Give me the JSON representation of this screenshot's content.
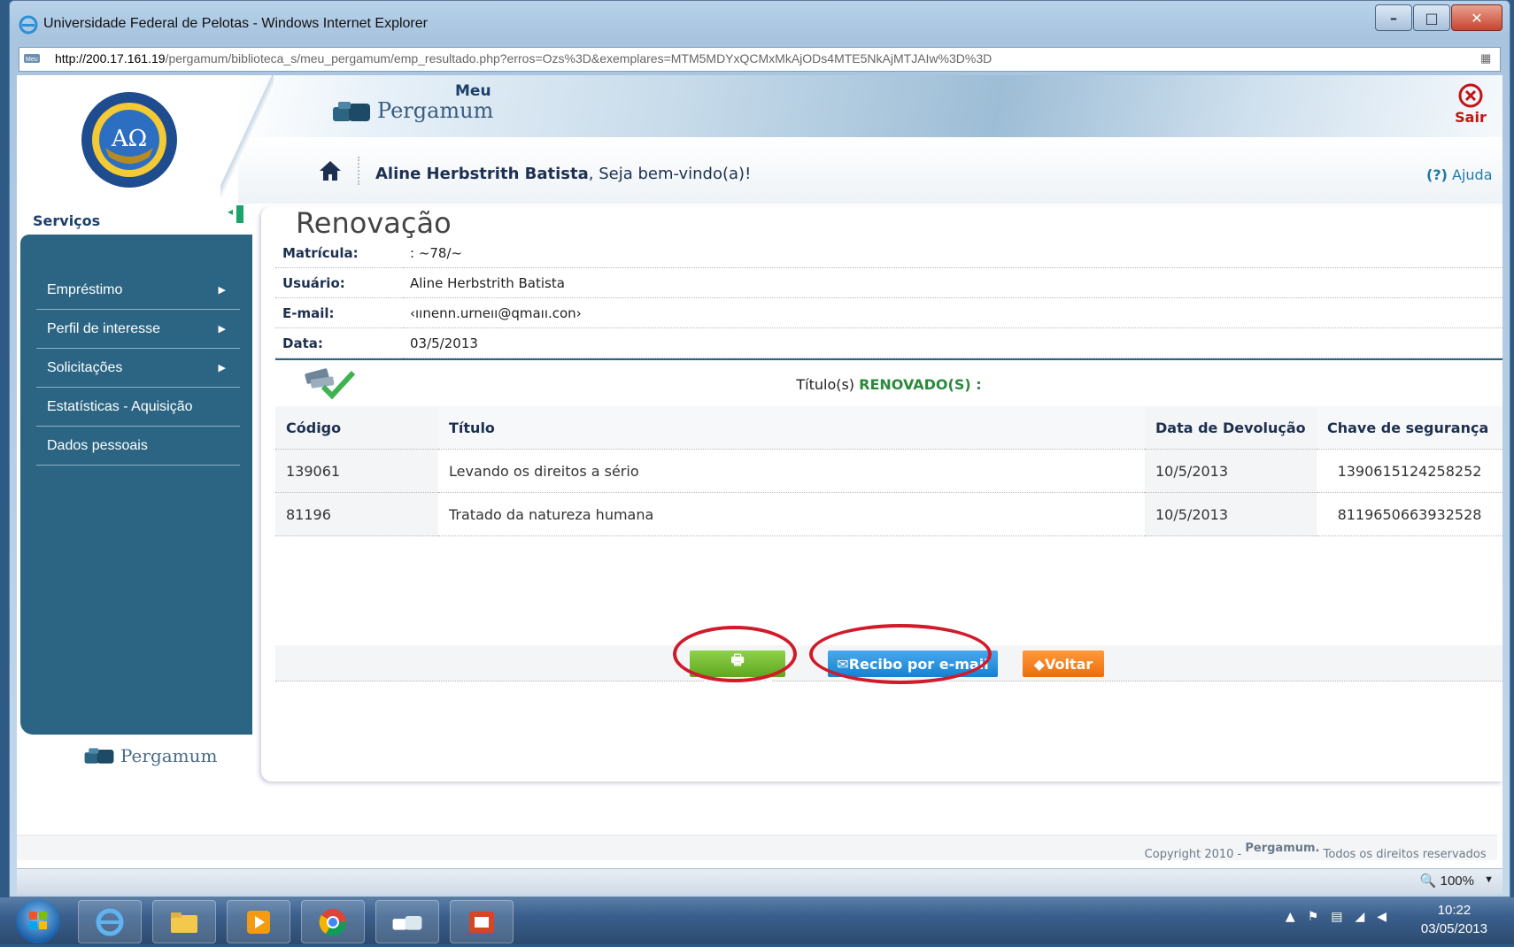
{
  "window": {
    "title": "Universidade Federal de Pelotas - Windows Internet Explorer",
    "url_host": "http://200.17.161.19",
    "url_path": "/pergamum/biblioteca_s/meu_pergamum/emp_resultado.php?erros=Ozs%3D&exemplares=MTM5MDYxQCMxMkAjODs4MTE5NkAjMTJAIw%3D%3D",
    "minimize": "–",
    "maximize": "□",
    "close": "✕"
  },
  "header": {
    "brand_meu": "Meu",
    "brand_name": "Pergamum",
    "logout_label": "Sair",
    "user_name": "Aline Herbstrith Batista",
    "welcome_suffix": ", Seja bem-vindo(a)!",
    "help_prefix": "(?)",
    "help_label": "Ajuda"
  },
  "sidebar": {
    "title": "Serviços",
    "items": [
      {
        "label": "Empréstimo",
        "arrow": "▶"
      },
      {
        "label": "Perfil de interesse",
        "arrow": "▶"
      },
      {
        "label": "Solicitações",
        "arrow": "▶"
      },
      {
        "label": "Estatísticas - Aquisição",
        "arrow": ""
      },
      {
        "label": "Dados pessoais",
        "arrow": ""
      }
    ],
    "footer_logo": "Pergamum"
  },
  "main": {
    "title": "Renovação",
    "info": [
      {
        "key": "Matrícula:",
        "value": ": ~78/~"
      },
      {
        "key": "Usuário:",
        "value": "Aline Herbstrith Batista"
      },
      {
        "key": "E-mail:",
        "value": "‹ıınenn.urneıı@qmaıı.con›"
      },
      {
        "key": "Data:",
        "value": "03/5/2013"
      }
    ],
    "renew_prefix": "Título(s) ",
    "renew_status": "RENOVADO(S) :",
    "columns": [
      "Código",
      "Título",
      "Data de Devolução",
      "Chave de segurança"
    ],
    "rows": [
      {
        "code": "139061",
        "title": "Levando os direitos a sério",
        "date": "10/5/2013",
        "key": "1390615124258252"
      },
      {
        "code": "81196",
        "title": "Tratado da natureza humana",
        "date": "10/5/2013",
        "key": "8119650663932528"
      }
    ],
    "buttons": {
      "print": "Imprimir",
      "email": "Recibo por e-mail",
      "back": "Voltar"
    }
  },
  "footer": {
    "copyright_prefix": "Copyright 2010 - ",
    "copyright_brand": "Pergamum.",
    "copyright_suffix": " Todos os direitos reservados"
  },
  "statusbar": {
    "zoom": "100%",
    "zoom_arrow": "▼"
  },
  "taskbar": {
    "time": "10:22",
    "date": "03/05/2013"
  },
  "colors": {
    "sidebar": "#2b6583",
    "print_button": "#6cb52a",
    "email_button": "#1e8ad9",
    "back_button": "#f07a18",
    "renewed": "#2a8a3c",
    "highlight_ring": "#d11a2a"
  }
}
